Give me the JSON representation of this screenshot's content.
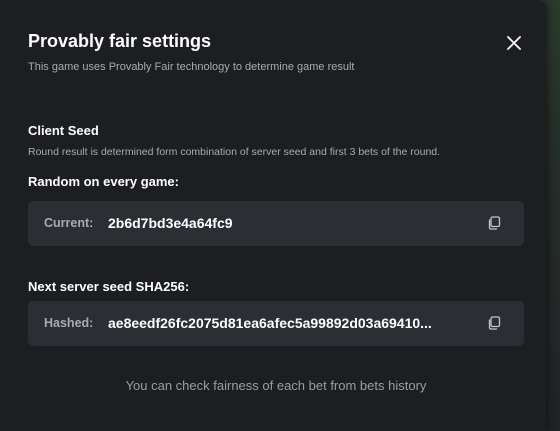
{
  "modal": {
    "title": "Provably fair settings",
    "subtitle": "This game uses Provably Fair technology to determine game result"
  },
  "client_seed": {
    "title": "Client Seed",
    "description": "Round result is determined form combination of server seed and first 3 bets of the round.",
    "mode_label": "Random on every game:",
    "current_key": "Current:",
    "current_value": "2b6d7bd3e4a64fc9"
  },
  "server_seed": {
    "label": "Next server seed SHA256:",
    "hashed_key": "Hashed:",
    "hashed_value": "ae8eedf26fc2075d81ea6afec5a99892d03a69410..."
  },
  "footer": {
    "text": "You can check fairness of each bet from bets history"
  },
  "icons": {
    "close": "close-icon",
    "copy": "copy-icon"
  },
  "colors": {
    "modal_bg": "#1c1e21",
    "field_bg": "#2b2e33",
    "text_primary": "#ffffff",
    "text_secondary": "#a8abb0"
  }
}
